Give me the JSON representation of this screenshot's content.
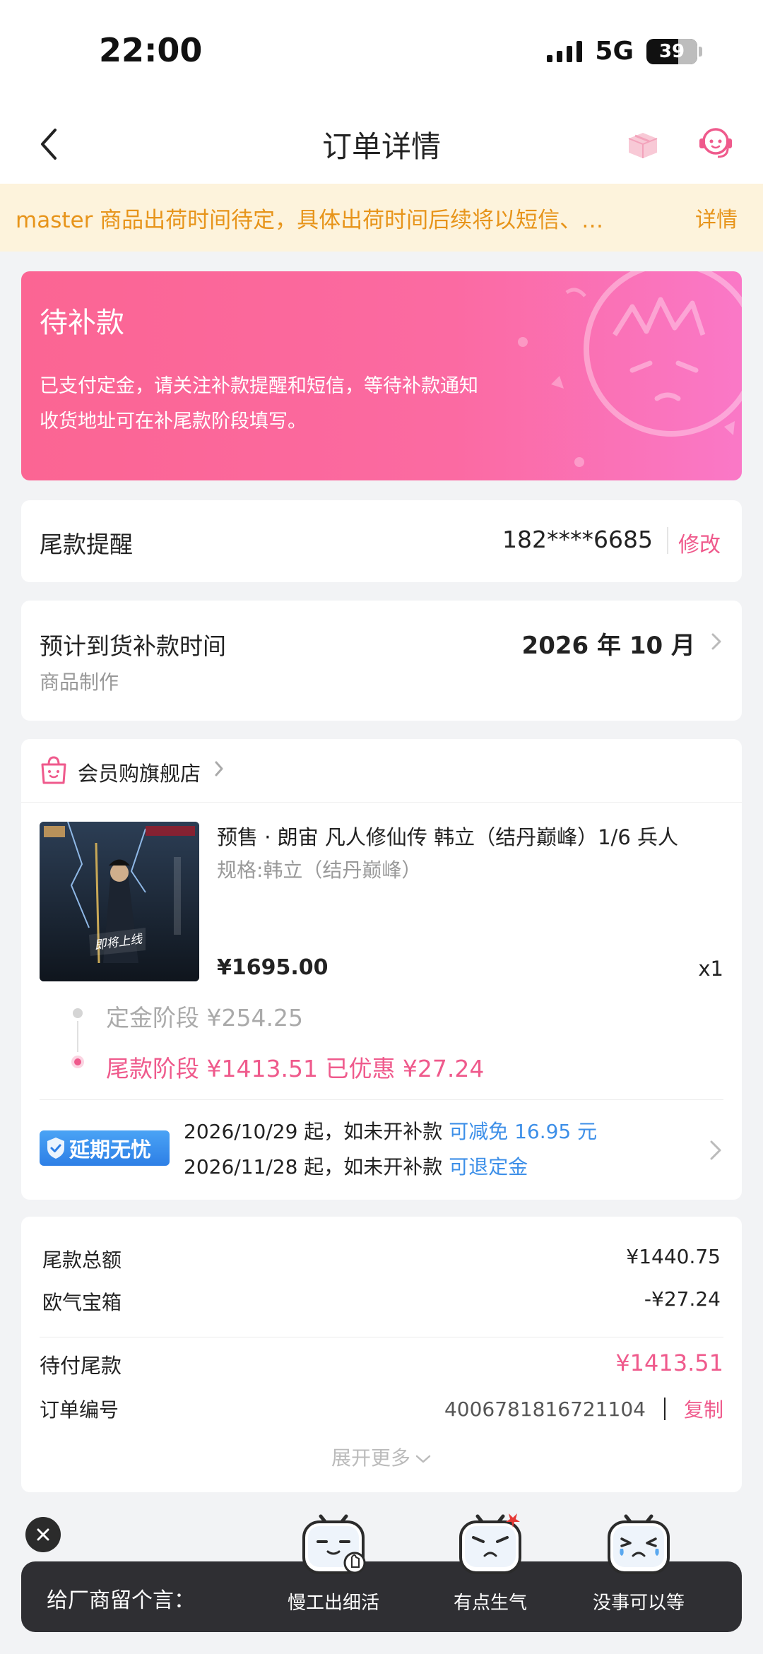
{
  "status_bar": {
    "time": "22:00",
    "network": "5G",
    "battery": "39"
  },
  "nav": {
    "title": "订单详情",
    "back_icon": "chevron-left-icon",
    "box_icon": "gift-box-icon",
    "service_icon": "customer-service-icon"
  },
  "notice": {
    "text": "master 商品出荷时间待定，具体出荷时间后续将以短信、…",
    "more": "详情"
  },
  "status_card": {
    "title": "待补款",
    "line1": "已支付定金，请关注补款提醒和短信，等待补款通知",
    "line2": "收货地址可在补尾款阶段填写。"
  },
  "remind": {
    "label": "尾款提醒",
    "phone": "182****6685",
    "edit": "修改"
  },
  "arrival": {
    "label": "预计到货补款时间",
    "sub": "商品制作",
    "date": "2026 年 10 月"
  },
  "shop": {
    "name": "会员购旗舰店"
  },
  "product": {
    "title": "预售 · 朗宙 凡人修仙传 韩立（结丹巅峰）1/6 兵人",
    "spec": "规格:韩立（结丹巅峰）",
    "price": "¥1695.00",
    "qty": "x1",
    "stage1": "定金阶段 ¥254.25",
    "stage2": "尾款阶段 ¥1413.51 已优惠 ¥27.24"
  },
  "delay": {
    "badge": "延期无忧",
    "line1_text": "2026/10/29 起，如未开补款 ",
    "line1_link": "可减免 16.95 元",
    "line2_text": "2026/11/28 起，如未开补款 ",
    "line2_link": "可退定金"
  },
  "summary": {
    "total_label": "尾款总额",
    "total_value": "¥1440.75",
    "box_label": "欧气宝箱",
    "box_value": "-¥27.24",
    "due_label": "待付尾款",
    "due_value": "¥1413.51",
    "order_label": "订单编号",
    "order_value": "400678181672110​4",
    "copy": "复制",
    "expand": "展开更多"
  },
  "message_bar": {
    "label": "给厂商留个言：",
    "options": [
      "慢工出细活",
      "有点生气",
      "没事可以等"
    ]
  },
  "colors": {
    "accent": "#ef5a8c",
    "notice": "#e7941a",
    "link": "#3d8fe8"
  }
}
